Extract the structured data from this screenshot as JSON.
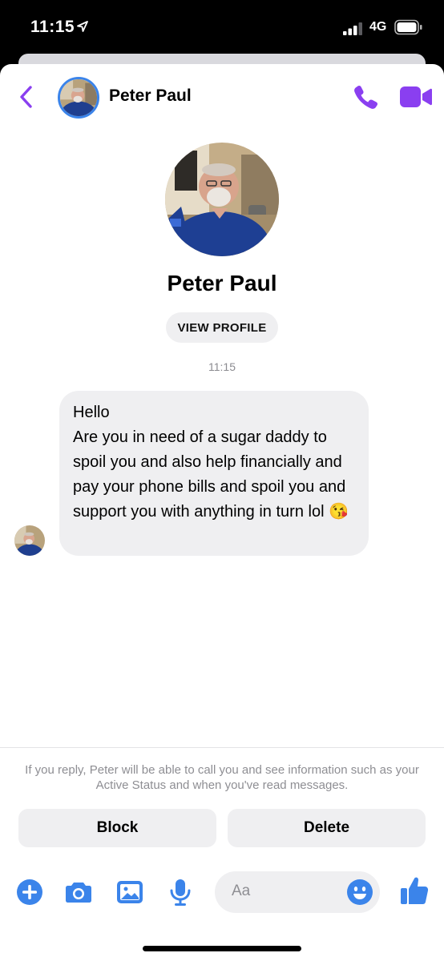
{
  "status_bar": {
    "time": "11:15",
    "network": "4G"
  },
  "header": {
    "contact_name": "Peter Paul"
  },
  "profile": {
    "name": "Peter Paul",
    "view_profile_label": "VIEW PROFILE"
  },
  "conversation": {
    "timestamp": "11:15",
    "messages": [
      {
        "from": "Peter Paul",
        "text": "Hello\nAre you in need of a sugar daddy to spoil you and also help financially and pay your phone bills and spoil you and support you with anything in turn lol 😘"
      }
    ]
  },
  "notice": "If you reply, Peter will be able to call you and see information such as your Active Status and when you've read messages.",
  "actions": {
    "block_label": "Block",
    "delete_label": "Delete"
  },
  "composer": {
    "placeholder": "Aa"
  },
  "colors": {
    "messenger_purple": "#8a3ff0",
    "messenger_blue": "#3b84ea",
    "bubble_gray": "#efeff1"
  }
}
